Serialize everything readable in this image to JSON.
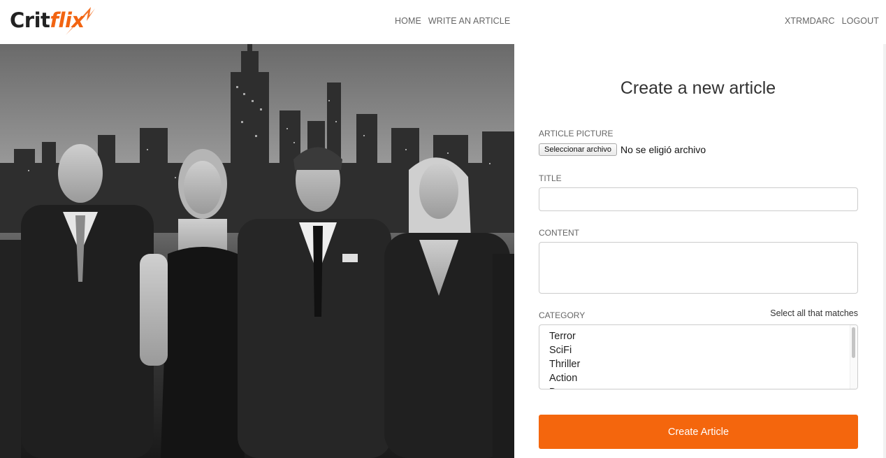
{
  "app": {
    "logo_part1": "Crit",
    "logo_part2": "flix",
    "brand_color": "#f26411"
  },
  "nav": {
    "center": [
      "HOME",
      "WRITE AN ARTICLE"
    ],
    "right": [
      "XTRMDARC",
      "LOGOUT"
    ]
  },
  "form": {
    "title": "Create a new article",
    "picture_label": "ARTICLE PICTURE",
    "file_button": "Seleccionar archivo",
    "file_status": "No se eligió archivo",
    "title_label": "TITLE",
    "title_value": "",
    "content_label": "CONTENT",
    "content_value": "",
    "category_label": "CATEGORY",
    "category_hint": "Select all that matches",
    "categories": [
      "Terror",
      "SciFi",
      "Thriller",
      "Action",
      "D"
    ],
    "submit_label": "Create Article",
    "submit_color": "#f4660d"
  }
}
